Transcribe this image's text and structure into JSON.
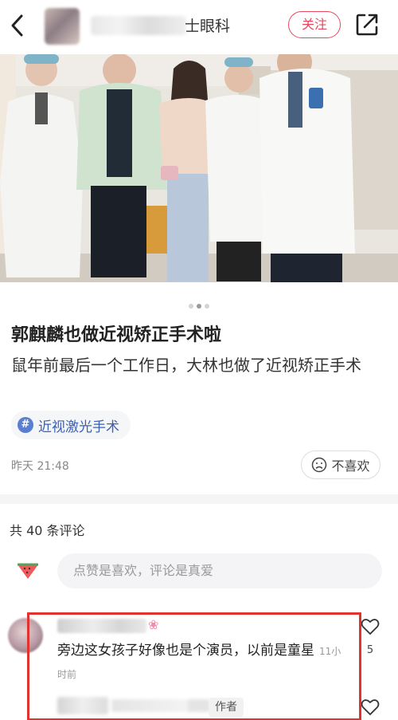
{
  "header": {
    "author_name_suffix": "士眼科",
    "follow_label": "关注"
  },
  "post": {
    "title": "郭麒麟也做近视矫正手术啦",
    "body": "鼠年前最后一个工作日，大林也做了近视矫正手术",
    "tag_icon": "#",
    "tag": "近视激光手术",
    "date": "昨天 21:48",
    "dislike_label": "不喜欢",
    "image_index": 2,
    "image_total": 3
  },
  "comments": {
    "count_label": "共 40 条评论",
    "input_placeholder": "点赞是喜欢，评论是真爱",
    "items": [
      {
        "text": "旁边这女孩子好像也是个演员，以前是童星",
        "time": "11小时前",
        "likes": "5"
      }
    ],
    "reply_badge": "作者"
  },
  "colors": {
    "accent": "#e8475d",
    "tag_blue": "#3b5fb8",
    "highlight_red": "#e0322e"
  }
}
